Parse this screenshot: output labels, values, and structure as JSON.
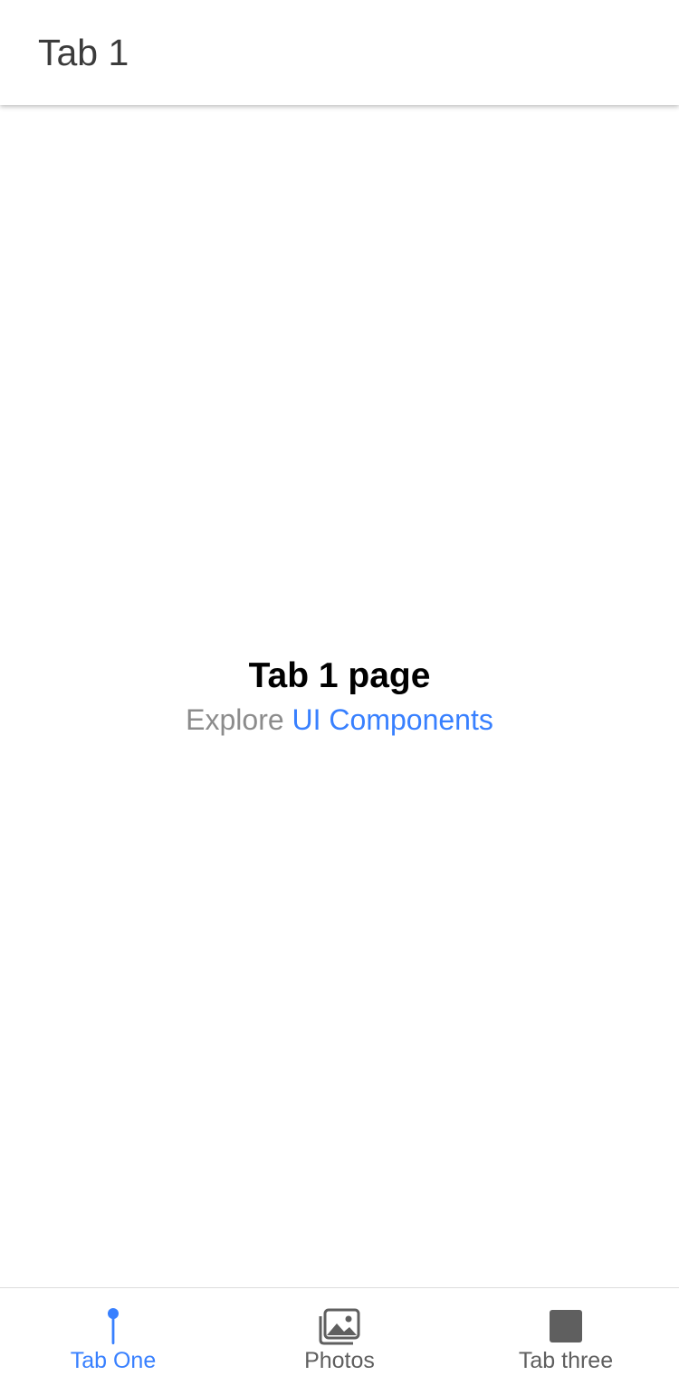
{
  "header": {
    "title": "Tab 1"
  },
  "main": {
    "heading": "Tab 1 page",
    "explore_text": "Explore",
    "link_text": "UI Components"
  },
  "tabs": [
    {
      "label": "Tab One",
      "icon": "pin-icon",
      "active": true
    },
    {
      "label": "Photos",
      "icon": "images-icon",
      "active": false
    },
    {
      "label": "Tab three",
      "icon": "square-icon",
      "active": false
    }
  ],
  "colors": {
    "accent": "#3880ff",
    "inactive": "#5f5f5f",
    "muted_text": "#8c8c8c"
  }
}
